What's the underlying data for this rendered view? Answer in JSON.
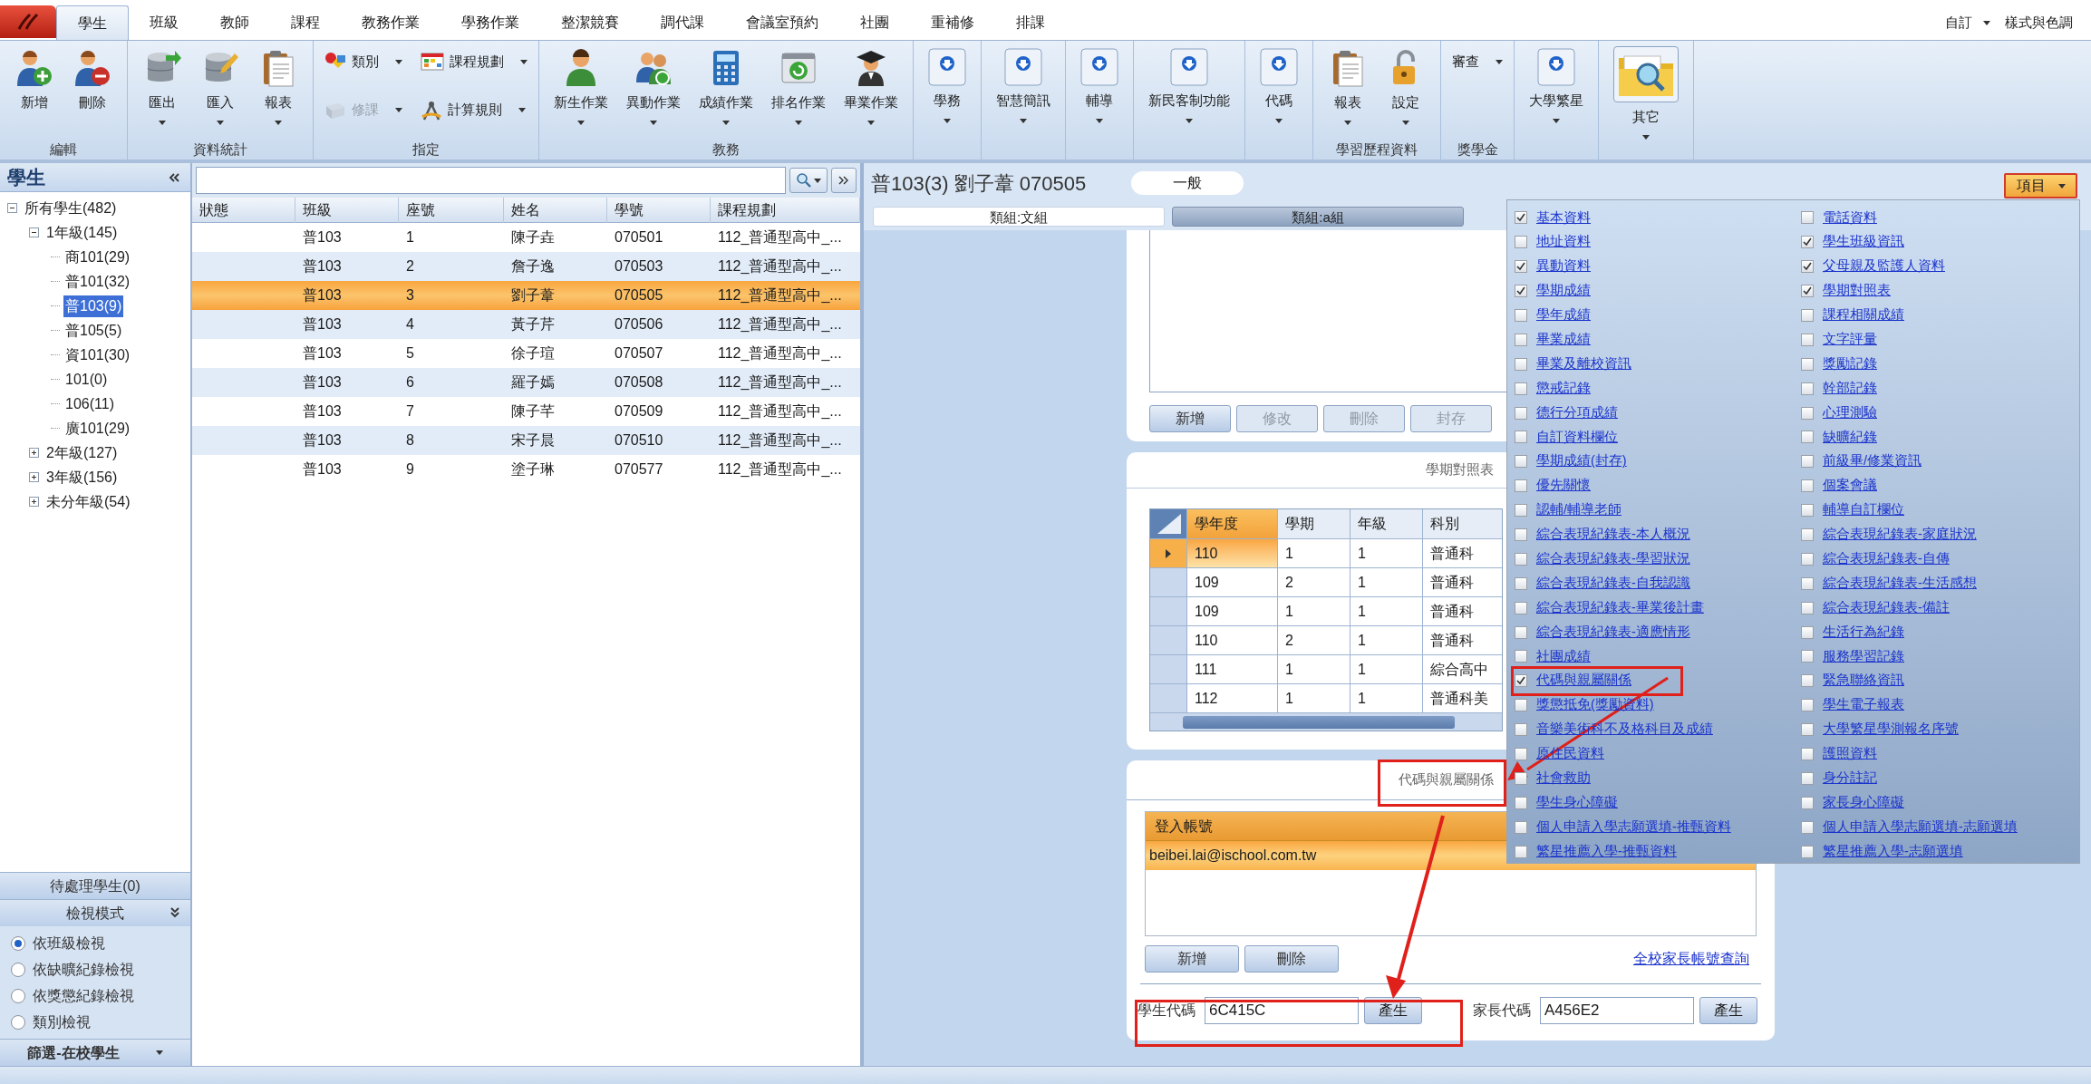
{
  "menu_tabs": [
    {
      "label": "學生",
      "selected": true
    },
    {
      "label": "班級",
      "selected": false
    },
    {
      "label": "教師",
      "selected": false
    },
    {
      "label": "課程",
      "selected": false
    },
    {
      "label": "教務作業",
      "selected": false
    },
    {
      "label": "學務作業",
      "selected": false
    },
    {
      "label": "整潔競賽",
      "selected": false
    },
    {
      "label": "調代課",
      "selected": false
    },
    {
      "label": "會議室預約",
      "selected": false
    },
    {
      "label": "社團",
      "selected": false
    },
    {
      "label": "重補修",
      "selected": false
    },
    {
      "label": "排課",
      "selected": false
    }
  ],
  "quick_access": [
    {
      "label": "自訂",
      "dropdown": true
    },
    {
      "label": "樣式與色調",
      "dropdown": false
    }
  ],
  "ribbon": [
    {
      "label": "編輯",
      "buttons": [
        {
          "label": "新增",
          "kind": "person-add",
          "dropdown": false
        },
        {
          "label": "刪除",
          "kind": "person-remove",
          "dropdown": false
        }
      ]
    },
    {
      "label": "資料統計",
      "buttons": [
        {
          "label": "匯出",
          "kind": "database-export",
          "dropdown": true
        },
        {
          "label": "匯入",
          "kind": "database-import",
          "dropdown": true
        },
        {
          "label": "報表",
          "kind": "clipboard",
          "dropdown": true
        }
      ]
    },
    {
      "label": "指定",
      "buttons": [
        {
          "label": "類別",
          "kind": "shapes",
          "dropdown": true,
          "disabled": false
        },
        {
          "label": "修課",
          "kind": "book",
          "dropdown": true,
          "disabled": true
        },
        {
          "label": "課程規劃",
          "kind": "calendar",
          "dropdown": true,
          "disabled": false
        },
        {
          "label": "計算規則",
          "kind": "compass",
          "dropdown": true,
          "disabled": false
        }
      ]
    },
    {
      "label": "教務",
      "buttons": [
        {
          "label": "新生作業",
          "kind": "person",
          "dropdown": true
        },
        {
          "label": "異動作業",
          "kind": "people",
          "dropdown": true
        },
        {
          "label": "成績作業",
          "kind": "calculator",
          "dropdown": true
        },
        {
          "label": "排名作業",
          "kind": "ranking",
          "dropdown": true
        },
        {
          "label": "畢業作業",
          "kind": "graduate",
          "dropdown": true
        }
      ]
    },
    {
      "buttons": [
        {
          "label": "學務",
          "kind": "arrow",
          "dropdown": true
        }
      ]
    },
    {
      "buttons": [
        {
          "label": "智慧簡訊",
          "kind": "arrow",
          "dropdown": true
        }
      ]
    },
    {
      "buttons": [
        {
          "label": "輔導",
          "kind": "arrow",
          "dropdown": true
        }
      ]
    },
    {
      "buttons": [
        {
          "label": "新民客制功能",
          "kind": "arrow",
          "dropdown": true
        }
      ]
    },
    {
      "buttons": [
        {
          "label": "代碼",
          "kind": "arrow",
          "dropdown": true
        }
      ]
    },
    {
      "label": "學習歷程資料",
      "buttons": [
        {
          "label": "報表",
          "kind": "clipboard",
          "dropdown": true
        },
        {
          "label": "設定",
          "kind": "padlock",
          "dropdown": true
        }
      ]
    },
    {
      "label": "獎學金",
      "buttons": [
        {
          "label": "審查",
          "kind": "text",
          "dropdown": true,
          "disabled": false
        }
      ]
    },
    {
      "buttons": [
        {
          "label": "大學繁星",
          "kind": "arrow",
          "dropdown": true
        }
      ]
    },
    {
      "buttons": [
        {
          "label": "其它",
          "kind": "folder",
          "dropdown": true
        }
      ]
    }
  ],
  "navigator": {
    "title": "學生",
    "tree": {
      "label": "所有學生(482)",
      "expanded": true,
      "selected": false,
      "children": [
        {
          "label": "1年級(145)",
          "expanded": true,
          "selected": false,
          "children": [
            {
              "label": "商101(29)",
              "selected": false
            },
            {
              "label": "普101(32)",
              "selected": false
            },
            {
              "label": "普103(9)",
              "selected": true
            },
            {
              "label": "普105(5)",
              "selected": false
            },
            {
              "label": "資101(30)",
              "selected": false
            },
            {
              "label": "101(0)",
              "selected": false
            },
            {
              "label": "106(11)",
              "selected": false
            },
            {
              "label": "廣101(29)",
              "selected": false
            }
          ]
        },
        {
          "label": "2年級(127)",
          "expanded": false,
          "selected": false
        },
        {
          "label": "3年級(156)",
          "expanded": false,
          "selected": false
        },
        {
          "label": "未分年級(54)",
          "expanded": false,
          "selected": false
        }
      ]
    },
    "pending": "待處理學生(0)",
    "view_mode_title": "檢視模式",
    "view_modes": [
      {
        "label": "依班級檢視",
        "selected": true
      },
      {
        "label": "依缺曠紀錄檢視",
        "selected": false
      },
      {
        "label": "依獎懲紀錄檢視",
        "selected": false
      },
      {
        "label": "類別檢視",
        "selected": false
      }
    ],
    "filter": "篩選-在校學生"
  },
  "student_list": {
    "columns": [
      "狀態",
      "班級",
      "座號",
      "姓名",
      "學號",
      "課程規劃"
    ],
    "rows": [
      {
        "class": "普103",
        "seat": "1",
        "name": "陳子垚",
        "student_id": "070501",
        "plan": "112_普通型高中_...",
        "selected": false
      },
      {
        "class": "普103",
        "seat": "2",
        "name": "詹子逸",
        "student_id": "070503",
        "plan": "112_普通型高中_...",
        "selected": false
      },
      {
        "class": "普103",
        "seat": "3",
        "name": "劉子葦",
        "student_id": "070505",
        "plan": "112_普通型高中_...",
        "selected": true
      },
      {
        "class": "普103",
        "seat": "4",
        "name": "黃子芹",
        "student_id": "070506",
        "plan": "112_普通型高中_...",
        "selected": false
      },
      {
        "class": "普103",
        "seat": "5",
        "name": "徐子瑄",
        "student_id": "070507",
        "plan": "112_普通型高中_...",
        "selected": false
      },
      {
        "class": "普103",
        "seat": "6",
        "name": "羅子嫣",
        "student_id": "070508",
        "plan": "112_普通型高中_...",
        "selected": false
      },
      {
        "class": "普103",
        "seat": "7",
        "name": "陳子芊",
        "student_id": "070509",
        "plan": "112_普通型高中_...",
        "selected": false
      },
      {
        "class": "普103",
        "seat": "8",
        "name": "宋子晨",
        "student_id": "070510",
        "plan": "112_普通型高中_...",
        "selected": false
      },
      {
        "class": "普103",
        "seat": "9",
        "name": "塗子琳",
        "student_id": "070577",
        "plan": "112_普通型高中_...",
        "selected": false
      }
    ]
  },
  "detail": {
    "title": "普103(3) 劉子葦 070505",
    "badge": "一般",
    "tabs": [
      {
        "label": "類組:文組",
        "selected": true
      },
      {
        "label": "類組:a組",
        "selected": false
      }
    ],
    "record_buttons": [
      {
        "label": "新增",
        "disabled": false
      },
      {
        "label": "修改",
        "disabled": true
      },
      {
        "label": "刪除",
        "disabled": true
      },
      {
        "label": "封存",
        "disabled": true
      }
    ],
    "semester_table": {
      "title": "學期對照表",
      "columns": [
        "學年度",
        "學期",
        "年級",
        "科別"
      ],
      "rows": [
        {
          "cells": [
            "110",
            "1",
            "1",
            "普通科"
          ],
          "selected": true
        },
        {
          "cells": [
            "109",
            "2",
            "1",
            "普通科"
          ],
          "selected": false
        },
        {
          "cells": [
            "109",
            "1",
            "1",
            "普通科"
          ],
          "selected": false
        },
        {
          "cells": [
            "110",
            "2",
            "1",
            "普通科"
          ],
          "selected": false
        },
        {
          "cells": [
            "111",
            "1",
            "1",
            "綜合高中"
          ],
          "selected": false
        },
        {
          "cells": [
            "112",
            "1",
            "1",
            "普通科美"
          ],
          "selected": false
        }
      ]
    },
    "codes_section": {
      "title": "代碼與親屬關係",
      "account_column": "登入帳號",
      "accounts": [
        {
          "value": "beibei.lai@ischool.com.tw",
          "selected": true
        }
      ],
      "buttons": [
        "新增",
        "刪除"
      ],
      "link": "全校家長帳號查詢",
      "codes": [
        {
          "label": "學生代碼",
          "value": "6C415C",
          "button": "產生"
        },
        {
          "label": "家長代碼",
          "value": "A456E2",
          "button": "產生"
        }
      ]
    }
  },
  "items_button": "項目",
  "item_checklist": {
    "columns": [
      {
        "items": [
          {
            "label": "基本資料",
            "checked": true
          },
          {
            "label": "地址資料",
            "checked": false
          },
          {
            "label": "異動資料",
            "checked": true
          },
          {
            "label": "學期成績",
            "checked": true
          },
          {
            "label": "學年成績",
            "checked": false
          },
          {
            "label": "畢業成績",
            "checked": false
          },
          {
            "label": "畢業及離校資訊",
            "checked": false
          },
          {
            "label": "懲戒記錄",
            "checked": false
          },
          {
            "label": "德行分項成績",
            "checked": false
          },
          {
            "label": "自訂資料欄位",
            "checked": false
          },
          {
            "label": "學期成績(封存)",
            "checked": false
          },
          {
            "label": "優先關懷",
            "checked": false
          },
          {
            "label": "認輔/輔導老師",
            "checked": false
          },
          {
            "label": "綜合表現紀錄表-本人概況",
            "checked": false
          },
          {
            "label": "綜合表現紀錄表-學習狀況",
            "checked": false
          },
          {
            "label": "綜合表現紀錄表-自我認識",
            "checked": false
          },
          {
            "label": "綜合表現紀錄表-畢業後計畫",
            "checked": false
          },
          {
            "label": "綜合表現紀錄表-適應情形",
            "checked": false
          },
          {
            "label": "社團成績",
            "checked": false
          },
          {
            "label": "代碼與親屬關係",
            "checked": true
          },
          {
            "label": "獎懲抵免(獎勵資料)",
            "checked": false
          },
          {
            "label": "音樂美術科不及格科目及成績",
            "checked": false
          },
          {
            "label": "原住民資料",
            "checked": false
          },
          {
            "label": "社會救助",
            "checked": false
          },
          {
            "label": "學生身心障礙",
            "checked": false
          },
          {
            "label": "個人申請入學志願選填-推甄資料",
            "checked": false
          },
          {
            "label": "繁星推薦入學-推甄資料",
            "checked": false
          }
        ]
      },
      {
        "items": [
          {
            "label": "電話資料",
            "checked": false
          },
          {
            "label": "學生班級資訊",
            "checked": true
          },
          {
            "label": "父母親及監護人資料",
            "checked": true
          },
          {
            "label": "學期對照表",
            "checked": true
          },
          {
            "label": "課程相關成績",
            "checked": false
          },
          {
            "label": "文字評量",
            "checked": false
          },
          {
            "label": "獎勵記錄",
            "checked": false
          },
          {
            "label": "幹部記錄",
            "checked": false
          },
          {
            "label": "心理測驗",
            "checked": false
          },
          {
            "label": "缺曠紀錄",
            "checked": false
          },
          {
            "label": "前級畢/修業資訊",
            "checked": false
          },
          {
            "label": "個案會議",
            "checked": false
          },
          {
            "label": "輔導自訂欄位",
            "checked": false
          },
          {
            "label": "綜合表現紀錄表-家庭狀況",
            "checked": false
          },
          {
            "label": "綜合表現紀錄表-自傳",
            "checked": false
          },
          {
            "label": "綜合表現紀錄表-生活感想",
            "checked": false
          },
          {
            "label": "綜合表現紀錄表-備註",
            "checked": false
          },
          {
            "label": "生活行為紀錄",
            "checked": false
          },
          {
            "label": "服務學習記錄",
            "checked": false
          },
          {
            "label": "緊急聯絡資訊",
            "checked": false
          },
          {
            "label": "學生電子報表",
            "checked": false
          },
          {
            "label": "大學繁星學測報名序號",
            "checked": false
          },
          {
            "label": "護照資料",
            "checked": false
          },
          {
            "label": "身分註記",
            "checked": false
          },
          {
            "label": "家長身心障礙",
            "checked": false
          },
          {
            "label": "個人申請入學志願選填-志願選填",
            "checked": false
          },
          {
            "label": "繁星推薦入學-志願選填",
            "checked": false
          }
        ]
      }
    ]
  }
}
